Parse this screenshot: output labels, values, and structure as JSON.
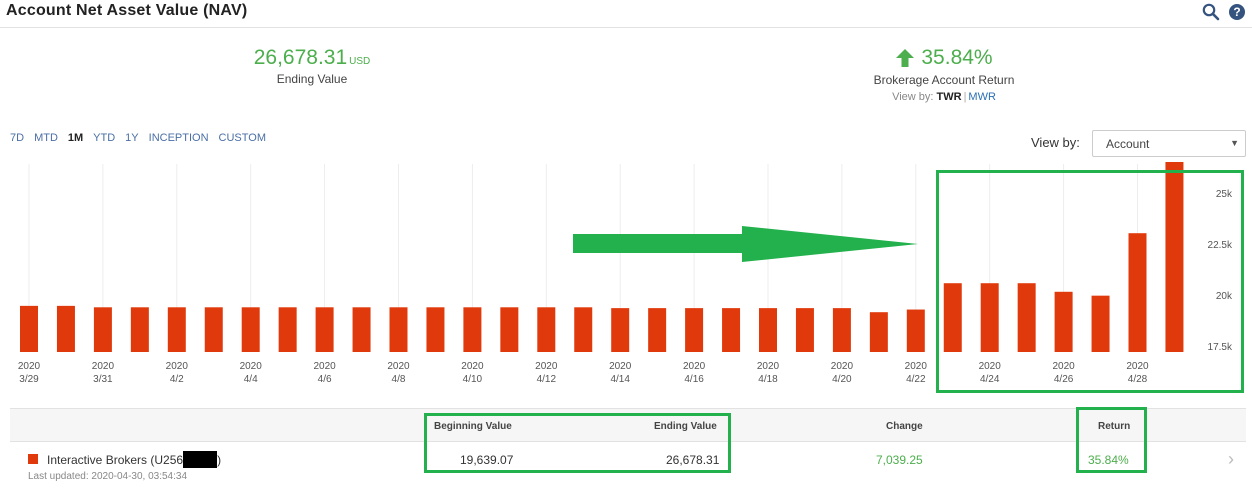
{
  "header": {
    "title": "Account Net Asset Value (NAV)"
  },
  "summary": {
    "ending_value": "26,678.31",
    "currency": "USD",
    "ending_label": "Ending Value",
    "return_value": "35.84%",
    "return_label": "Brokerage Account Return",
    "view_by_prefix": "View by:",
    "twr": "TWR",
    "mwr": "MWR",
    "separator": "|"
  },
  "range_tabs": [
    {
      "label": "7D"
    },
    {
      "label": "MTD"
    },
    {
      "label": "1M"
    },
    {
      "label": "YTD"
    },
    {
      "label": "1Y"
    },
    {
      "label": "INCEPTION"
    },
    {
      "label": "CUSTOM"
    }
  ],
  "active_range": "1M",
  "view_by": {
    "label": "View by:",
    "selected": "Account"
  },
  "chart_data": {
    "type": "bar",
    "x": [
      "3/29",
      "3/30",
      "3/31",
      "4/1",
      "4/2",
      "4/3",
      "4/4",
      "4/5",
      "4/6",
      "4/7",
      "4/8",
      "4/9",
      "4/10",
      "4/11",
      "4/12",
      "4/13",
      "4/14",
      "4/15",
      "4/16",
      "4/17",
      "4/18",
      "4/19",
      "4/20",
      "4/21",
      "4/22",
      "4/23",
      "4/24",
      "4/25",
      "4/26",
      "4/27",
      "4/28",
      "4/29"
    ],
    "values": [
      19460,
      19460,
      19390,
      19390,
      19390,
      19390,
      19390,
      19390,
      19390,
      19390,
      19390,
      19390,
      19390,
      19390,
      19390,
      19390,
      19350,
      19350,
      19350,
      19350,
      19350,
      19350,
      19350,
      19150,
      19280,
      20570,
      20570,
      20570,
      20150,
      19960,
      23020,
      26680
    ],
    "tick_labels": [
      {
        "year": "2020",
        "date": "3/29"
      },
      {
        "year": "2020",
        "date": "3/31"
      },
      {
        "year": "2020",
        "date": "4/2"
      },
      {
        "year": "2020",
        "date": "4/4"
      },
      {
        "year": "2020",
        "date": "4/6"
      },
      {
        "year": "2020",
        "date": "4/8"
      },
      {
        "year": "2020",
        "date": "4/10"
      },
      {
        "year": "2020",
        "date": "4/12"
      },
      {
        "year": "2020",
        "date": "4/14"
      },
      {
        "year": "2020",
        "date": "4/16"
      },
      {
        "year": "2020",
        "date": "4/18"
      },
      {
        "year": "2020",
        "date": "4/20"
      },
      {
        "year": "2020",
        "date": "4/22"
      },
      {
        "year": "2020",
        "date": "4/24"
      },
      {
        "year": "2020",
        "date": "4/26"
      },
      {
        "year": "2020",
        "date": "4/28"
      }
    ],
    "y_ticks": [
      "17.5k",
      "20k",
      "22.5k",
      "25k"
    ],
    "ylim": [
      17200,
      26900
    ],
    "legend": "none",
    "grid": "vertical",
    "color": "#e03a0c"
  },
  "table": {
    "headers": {
      "beginning": "Beginning Value",
      "ending": "Ending Value",
      "change": "Change",
      "return": "Return"
    },
    "row": {
      "account": "Interactive Brokers (U256",
      "account_suffix": ")",
      "updated": "Last updated: 2020-04-30, 03:54:34",
      "beginning": "19,639.07",
      "ending": "26,678.31",
      "change": "7,039.25",
      "return": "35.84%"
    }
  },
  "colors": {
    "accent_green": "#4cae4c",
    "bar_red": "#e03a0c",
    "annotation_green": "#22b14c"
  }
}
